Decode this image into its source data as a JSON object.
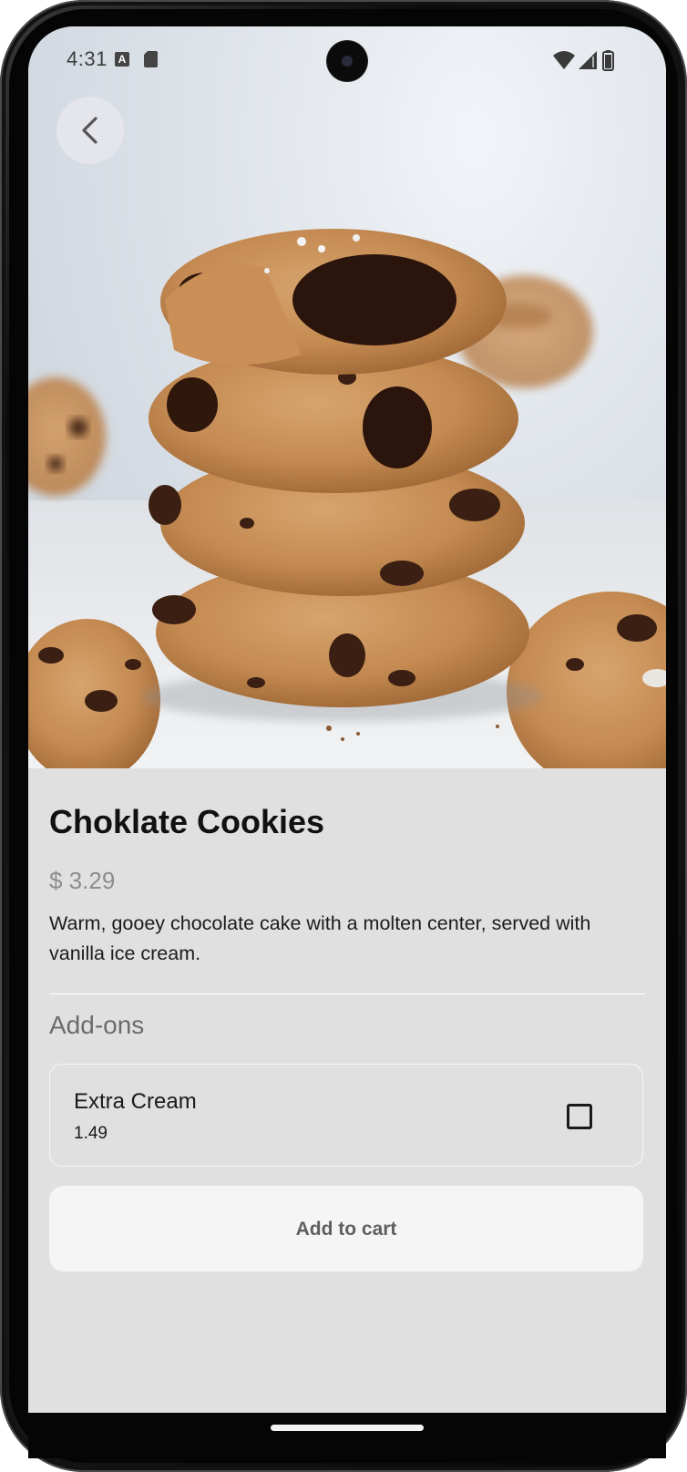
{
  "status_bar": {
    "time": "4:31",
    "notification_icons": [
      "a-letter-icon",
      "sd-card-icon"
    ],
    "system_icons": [
      "wifi-icon",
      "cell-signal-icon",
      "battery-icon"
    ]
  },
  "hero": {
    "image_subject": "stack of chocolate chip cookies",
    "back_icon": "chevron-left-icon"
  },
  "product": {
    "title": "Choklate Cookies",
    "price": "$ 3.29",
    "description": "Warm, gooey chocolate cake with a molten center, served with vanilla ice cream."
  },
  "addons": {
    "heading": "Add-ons",
    "items": [
      {
        "name": "Extra Cream",
        "price": "1.49",
        "checked": false
      }
    ]
  },
  "actions": {
    "add_to_cart_label": "Add to cart"
  },
  "colors": {
    "screen_background": "#e0e0e0",
    "title_text": "#111111",
    "price_text": "#8d8d8d",
    "button_background": "#f5f5f5",
    "button_text": "#5f5f5f"
  }
}
